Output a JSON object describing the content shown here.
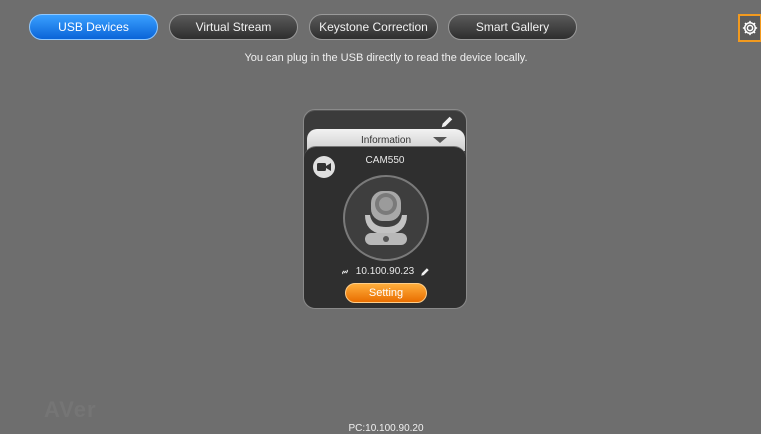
{
  "tabs": [
    {
      "label": "USB Devices",
      "active": true
    },
    {
      "label": "Virtual Stream",
      "active": false
    },
    {
      "label": "Keystone Correction",
      "active": false
    },
    {
      "label": "Smart Gallery",
      "active": false
    }
  ],
  "settings_icon": "gear-icon",
  "hint": "You can plug in the USB directly to read the device locally.",
  "device_card": {
    "info_label": "Information",
    "model": "CAM550",
    "ip": "10.100.90.23",
    "setting_label": "Setting",
    "icons": [
      "edit-icon",
      "camera-icon",
      "link-icon",
      "chevron-down-icon"
    ]
  },
  "watermark": "AVer",
  "footer": "PC:10.100.90.20",
  "colors": {
    "background": "#6e6e6e",
    "active_tab": "#1a7ef0",
    "accent_orange": "#f29a1f",
    "setting_button": "#f28a14"
  }
}
